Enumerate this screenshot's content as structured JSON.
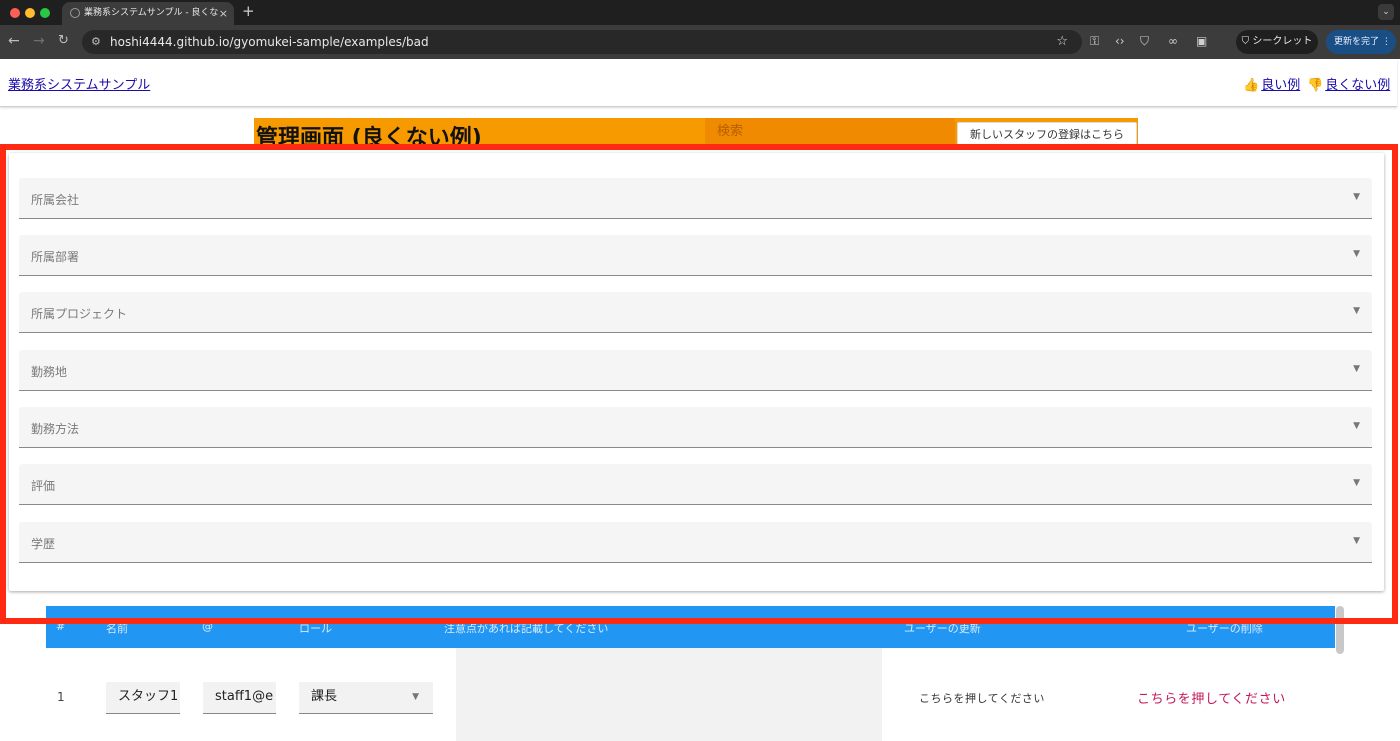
{
  "browser": {
    "tab_title": "業務系システムサンプル - 良くな",
    "tab_close": "×",
    "new_tab": "+",
    "url": "hoshi4444.github.io/gyomukei-sample/examples/bad",
    "incognito_label": "シークレット",
    "update_label": "更新を完了"
  },
  "header": {
    "site_title": "業務系システムサンプル",
    "good_example": "良い例",
    "bad_example": "良くない例"
  },
  "admin": {
    "title": "管理画面 (良くない例)",
    "search_placeholder": "検索",
    "new_staff_button": "新しいスタッフの登録はこちら"
  },
  "filters": [
    {
      "label": "所属会社"
    },
    {
      "label": "所属部署"
    },
    {
      "label": "所属プロジェクト"
    },
    {
      "label": "勤務地"
    },
    {
      "label": "勤務方法"
    },
    {
      "label": "評価"
    },
    {
      "label": "学歴"
    }
  ],
  "table": {
    "headers": [
      "#",
      "名前",
      "@",
      "ロール",
      "注意点があれば記載してください",
      "ユーザーの更新",
      "ユーザーの削除"
    ],
    "rows": [
      {
        "num": "1",
        "name": "スタッフ1",
        "email": "staff1@e",
        "role": "課長",
        "update": "こちらを押してください",
        "delete": "こちらを押してください"
      }
    ]
  },
  "colors": {
    "accent_orange": "#f79a00",
    "table_header_blue": "#2196f3",
    "highlight_red": "#ff2a12",
    "delete_red": "#c2185b"
  }
}
